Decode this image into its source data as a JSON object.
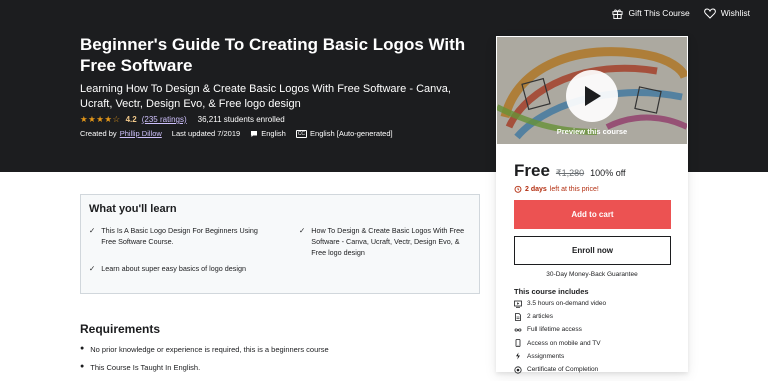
{
  "topbar": {
    "gift_label": "Gift This Course",
    "wishlist_label": "Wishlist"
  },
  "course": {
    "title": "Beginner's Guide To Creating Basic Logos With Free Software",
    "subtitle": "Learning How To Design & Create Basic Logos With Free Software - Canva, Ucraft, Vectr, Design Evo, & Free logo design",
    "rating": "4.2",
    "ratings_count": "(235 ratings)",
    "students": "36,211 students enrolled",
    "created_by_prefix": "Created by",
    "instructor": "Phillip Dillow",
    "last_updated": "Last updated 7/2019",
    "language": "English",
    "captions_badge": "CC",
    "captions": "English [Auto-generated]"
  },
  "sidebar": {
    "preview_label": "Preview this course",
    "price": "Free",
    "original_price": "₹1,280",
    "discount": "100% off",
    "timer_bold": "2 days",
    "timer_rest": "left at this price!",
    "add_to_cart": "Add to cart",
    "enroll": "Enroll now",
    "guarantee": "30-Day Money-Back Guarantee",
    "includes_heading": "This course includes",
    "includes": [
      {
        "icon": "video-icon",
        "label": "3.5 hours on-demand video"
      },
      {
        "icon": "file-icon",
        "label": "2 articles"
      },
      {
        "icon": "infinity-icon",
        "label": "Full lifetime access"
      },
      {
        "icon": "mobile-icon",
        "label": "Access on mobile and TV"
      },
      {
        "icon": "assignment-icon",
        "label": "Assignments"
      },
      {
        "icon": "trophy-icon",
        "label": "Certificate of Completion"
      }
    ]
  },
  "learn": {
    "heading": "What you'll learn",
    "items": [
      "This Is A Basic Logo Design For Beginners Using Free Software Course.",
      "How To Design & Create Basic Logos With Free Software - Canva, Ucraft, Vectr, Design Evo, & Free logo design",
      "Learn about super easy basics of logo design"
    ]
  },
  "requirements": {
    "heading": "Requirements",
    "items": [
      "No prior knowledge or experience is required, this is a beginners course",
      "This Course Is Taught In English."
    ]
  },
  "colors": {
    "hero_bg": "#1c1d1f",
    "cart_button": "#ec5252",
    "star": "#e59819",
    "rating_number": "#f3ca8c",
    "link_purple": "#cec0fc",
    "timer_red": "#b32d0f"
  }
}
